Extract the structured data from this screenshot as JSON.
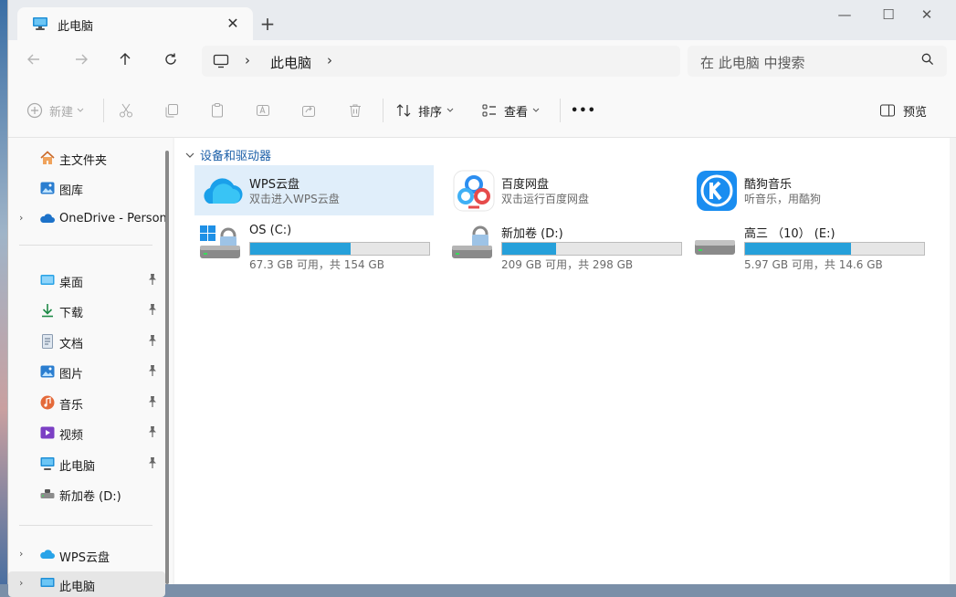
{
  "tab": {
    "title": "此电脑",
    "close": "✕",
    "new": "+"
  },
  "window_controls": {
    "minimize": "—",
    "maximize": "☐",
    "close": "✕"
  },
  "address": {
    "crumb": "此电脑",
    "sep": "›"
  },
  "search": {
    "placeholder": "在 此电脑 中搜索"
  },
  "toolbar": {
    "new_label": "新建",
    "sort_label": "排序",
    "view_label": "查看",
    "more_label": "•••",
    "preview_label": "预览"
  },
  "sidebar": {
    "items": [
      {
        "label": "主文件夹",
        "icon": "home-icon"
      },
      {
        "label": "图库",
        "icon": "gallery-icon"
      },
      {
        "label": "OneDrive - Person",
        "icon": "onedrive-icon"
      },
      {
        "label": "桌面",
        "icon": "desktop-icon"
      },
      {
        "label": "下载",
        "icon": "download-icon"
      },
      {
        "label": "文档",
        "icon": "document-icon"
      },
      {
        "label": "图片",
        "icon": "pictures-icon"
      },
      {
        "label": "音乐",
        "icon": "music-icon"
      },
      {
        "label": "视频",
        "icon": "video-icon"
      },
      {
        "label": "此电脑",
        "icon": "computer-icon"
      },
      {
        "label": "新加卷 (D:)",
        "icon": "drive-icon"
      },
      {
        "label": "WPS云盘",
        "icon": "cloud-icon"
      },
      {
        "label": "此电脑",
        "icon": "computer-icon"
      }
    ]
  },
  "main": {
    "group_title": "设备和驱动器",
    "tiles": [
      {
        "name": "WPS云盘",
        "sub": "双击进入WPS云盘",
        "icon": "wps-cloud-icon"
      },
      {
        "name": "百度网盘",
        "sub": "双击运行百度网盘",
        "icon": "baidu-netdisk-icon"
      },
      {
        "name": "酷狗音乐",
        "sub": "听音乐，用酷狗",
        "icon": "kugou-music-icon"
      }
    ],
    "drives": [
      {
        "name": "OS (C:)",
        "free": "67.3 GB 可用，共 154 GB",
        "used_fraction": 0.56,
        "icon": "windows-drive-icon"
      },
      {
        "name": "新加卷 (D:)",
        "free": "209 GB 可用，共 298 GB",
        "used_fraction": 0.3,
        "icon": "locked-drive-icon"
      },
      {
        "name": "高三 （10） (E:)",
        "free": "5.97 GB 可用，共 14.6 GB",
        "used_fraction": 0.59,
        "icon": "removable-drive-icon"
      }
    ]
  },
  "colors": {
    "accent": "#26a0da",
    "selected": "#e0eefa",
    "link": "#1b5fa8"
  }
}
